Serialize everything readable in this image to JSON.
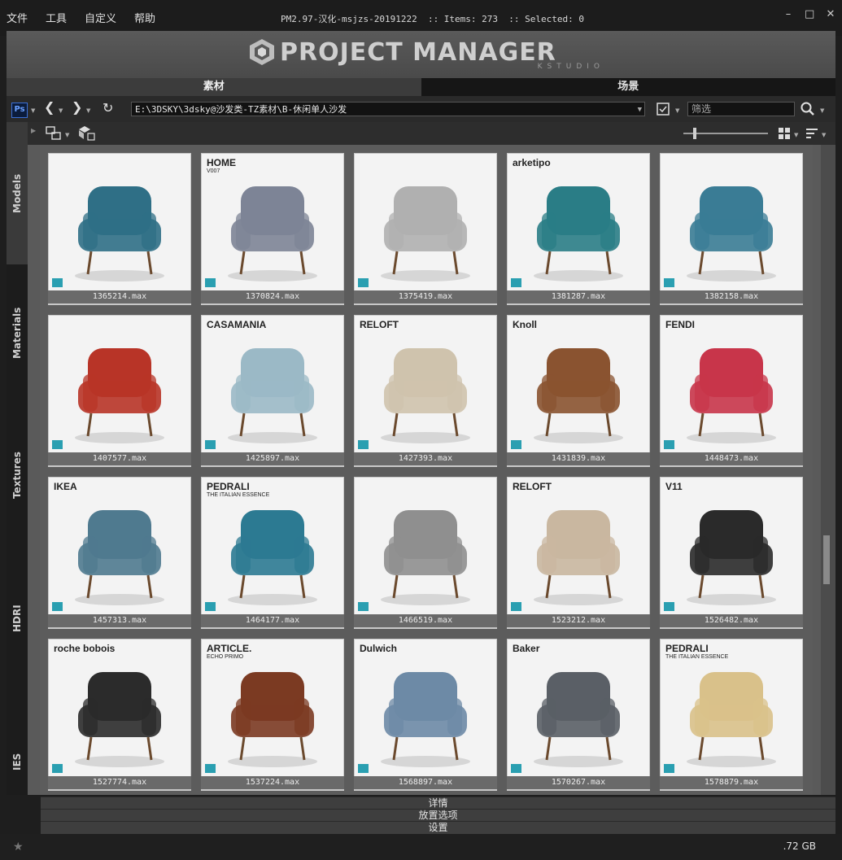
{
  "menu": [
    "文件",
    "工具",
    "自定义",
    "帮助"
  ],
  "window": {
    "title": "PM2.97-汉化-msjzs-20191222  :: Items: 273  :: Selected: 0"
  },
  "banner": {
    "logo_text": "PROJECT MANAGER",
    "logo_sub": "KSTUDIO"
  },
  "tabs": [
    {
      "label": "素材",
      "active": true
    },
    {
      "label": "场景",
      "active": false
    }
  ],
  "toolbar": {
    "ps_label": "Ps",
    "path": "E:\\3DSKY\\3dsky@沙发类-TZ素材\\B-休闲单人沙发",
    "filter_placeholder": "筛选"
  },
  "side_tabs": [
    "Models",
    "Materials",
    "Textures",
    "HDRI",
    "IES"
  ],
  "items": [
    {
      "file": "1365214.max",
      "color": "#2f6f86"
    },
    {
      "file": "1370824.max",
      "color": "#7d8496"
    },
    {
      "file": "1375419.max",
      "color": "#b0b0b0"
    },
    {
      "file": "1381287.max",
      "color": "#2a7d86"
    },
    {
      "file": "1382158.max",
      "color": "#3a7c95"
    },
    {
      "file": "1407577.max",
      "color": "#b83427"
    },
    {
      "file": "1425897.max",
      "color": "#9bb9c6"
    },
    {
      "file": "1427393.max",
      "color": "#cfc3ad"
    },
    {
      "file": "1431839.max",
      "color": "#8a5330"
    },
    {
      "file": "1448473.max",
      "color": "#c8354a"
    },
    {
      "file": "1457313.max",
      "color": "#4f7a8f"
    },
    {
      "file": "1464177.max",
      "color": "#2c7a92"
    },
    {
      "file": "1466519.max",
      "color": "#8f8f8f"
    },
    {
      "file": "1523212.max",
      "color": "#c9b7a0"
    },
    {
      "file": "1526482.max",
      "color": "#2a2a2a"
    },
    {
      "file": "1527774.max",
      "color": "#2b2b2b"
    },
    {
      "file": "1537224.max",
      "color": "#7b3a22"
    },
    {
      "file": "1568897.max",
      "color": "#6d8aa6"
    },
    {
      "file": "1570267.max",
      "color": "#5a5f66"
    },
    {
      "file": "1578879.max",
      "color": "#d9c18a"
    }
  ],
  "thumb_labels": {
    "1370824": [
      "HOME",
      "V007"
    ],
    "1381287": [
      "arketipo"
    ],
    "1425897": [
      "CASAMANIA"
    ],
    "1427393": [
      "RELOFT"
    ],
    "1431839": [
      "Knoll"
    ],
    "1448473": [
      "FENDI"
    ],
    "1457313": [
      "IKEA"
    ],
    "1464177": [
      "PEDRALI",
      "THE ITALIAN ESSENCE"
    ],
    "1523212": [
      "RELOFT"
    ],
    "1526482": [
      "V11"
    ],
    "1527774": [
      "roche bobois"
    ],
    "1537224": [
      "ARTICLE.",
      "ECHO PRIMO"
    ],
    "1568897": [
      "Dulwich"
    ],
    "1570267": [
      "Baker"
    ],
    "1578879": [
      "PEDRALI",
      "THE ITALIAN ESSENCE"
    ]
  },
  "panels": [
    "详情",
    "放置选项",
    "设置"
  ],
  "status": {
    "disk": ".72 GB"
  },
  "colors": {
    "accent": "#2a9fb1",
    "background": "#1e1e1e",
    "grid_bg": "#5c5c5c"
  }
}
